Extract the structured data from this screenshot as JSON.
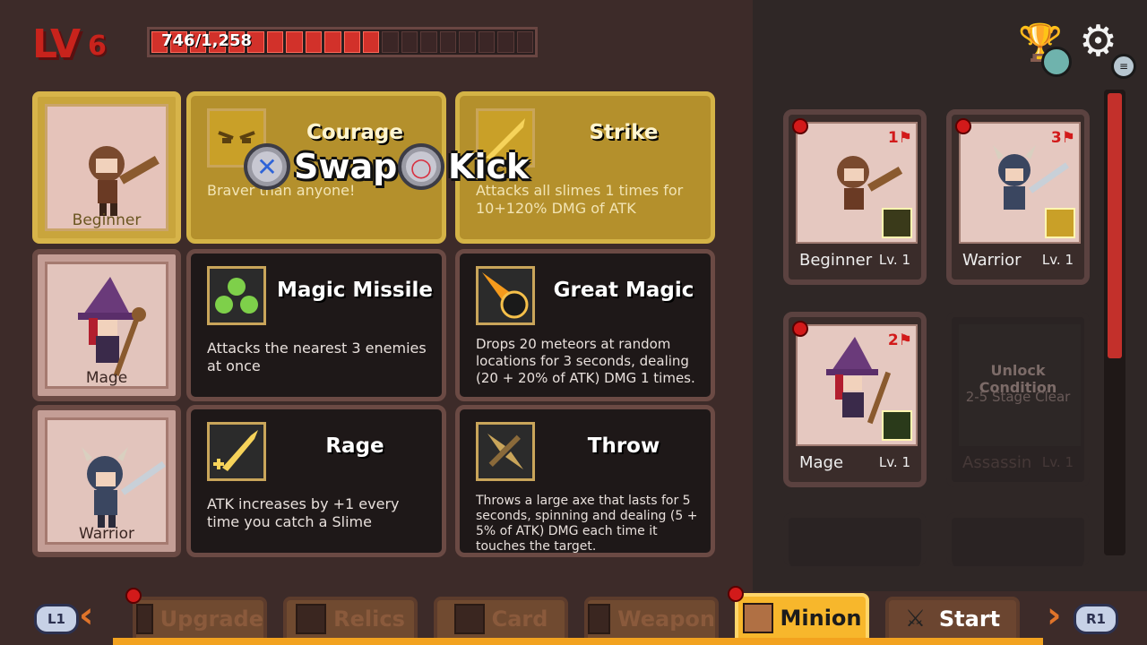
{
  "header": {
    "level_label": "LV",
    "level_value": "6",
    "xp_text": "746/1,258",
    "xp_progress": 0.593
  },
  "rows": [
    {
      "portrait_name": "Beginner",
      "selected": true,
      "skills": [
        {
          "title": "Courage",
          "desc": "Braver than anyone!",
          "icon": "angry-face-icon"
        },
        {
          "title": "Strike",
          "desc": "Attacks all slimes 1 times for 10+120% DMG of ATK",
          "icon": "sword-icon"
        }
      ]
    },
    {
      "portrait_name": "Mage",
      "selected": false,
      "skills": [
        {
          "title": "Magic Missile",
          "desc": "Attacks the nearest 3 enemies at once",
          "icon": "slime-trio-icon"
        },
        {
          "title": "Great Magic",
          "desc": "Drops 20 meteors at random locations for 3 seconds, dealing (20 + 20% of ATK) DMG 1 times.",
          "icon": "meteor-icon"
        }
      ]
    },
    {
      "portrait_name": "Warrior",
      "selected": false,
      "skills": [
        {
          "title": "Rage",
          "desc": "ATK increases by +1 every time you catch a Slime",
          "icon": "sword-plus-icon"
        },
        {
          "title": "Throw",
          "desc": "Throws a large axe that lasts for 5 seconds, spinning and dealing (5 + 5% of ATK) DMG each time it touches the target.",
          "icon": "axe-icon"
        }
      ]
    }
  ],
  "prompts": {
    "swap_label": "Swap",
    "kick_label": "Kick"
  },
  "minions": [
    {
      "name": "Beginner",
      "level": "Lv. 1",
      "rank": "1",
      "locked": false
    },
    {
      "name": "Warrior",
      "level": "Lv. 1",
      "rank": "3",
      "locked": false
    },
    {
      "name": "Mage",
      "level": "Lv. 1",
      "rank": "2",
      "locked": false
    },
    {
      "name": "Assassin",
      "level": "Lv. 1",
      "locked": true,
      "unlock_title": "Unlock Condition",
      "unlock_sub": "2-5 Stage Clear"
    }
  ],
  "nav": {
    "left_shoulder": "L1",
    "right_shoulder": "R1",
    "tabs": [
      "Upgrade",
      "Relics",
      "Card",
      "Weapon",
      "Minion",
      "Start"
    ],
    "active_tab": "Minion"
  },
  "colors": {
    "accent": "#f7b72c",
    "xp_fill": "#d2312a",
    "selected_row": "#b4902c",
    "alert_dot": "#d21a1a"
  }
}
